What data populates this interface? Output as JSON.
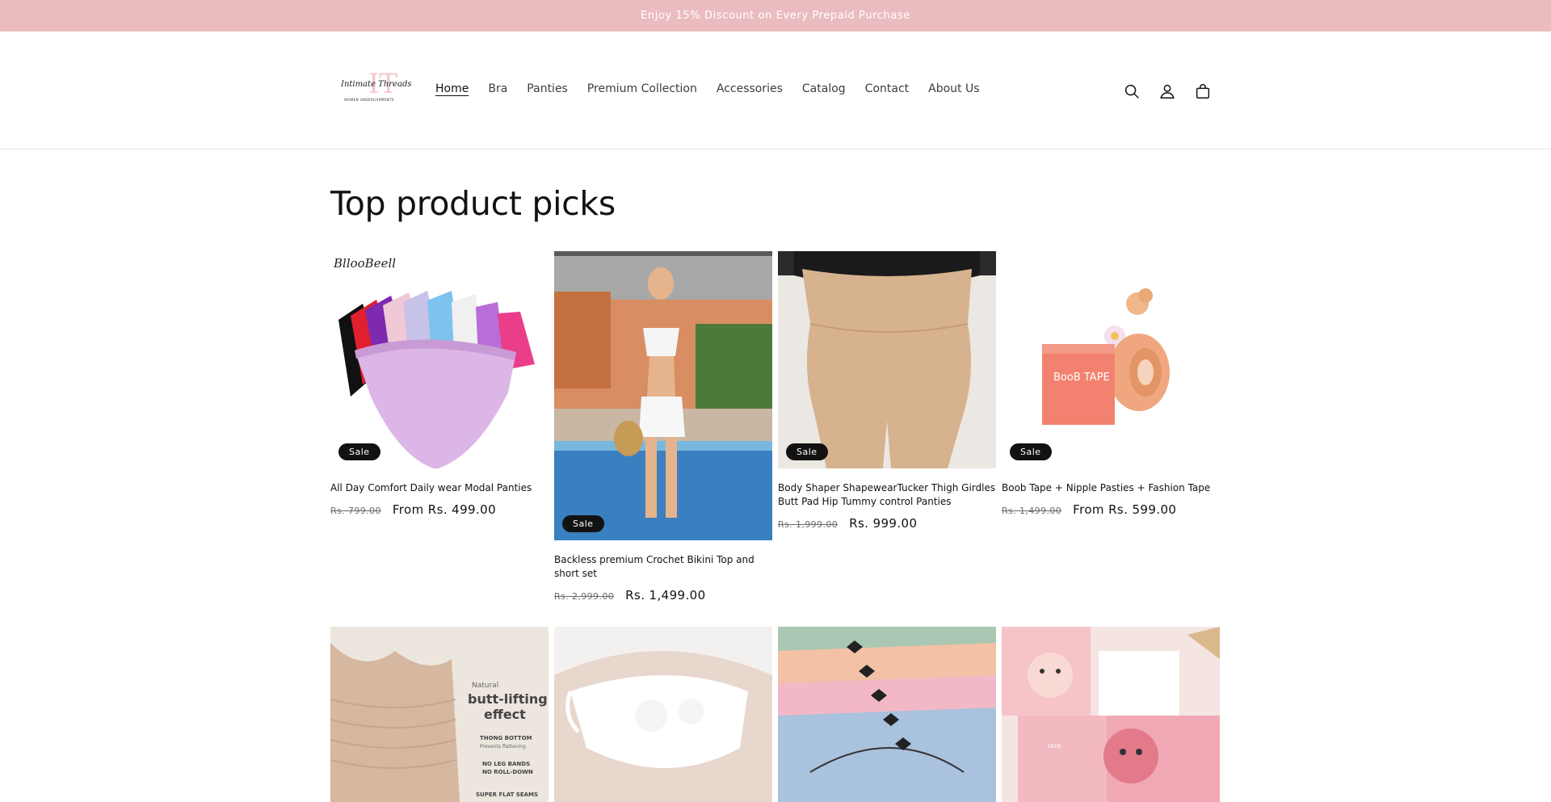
{
  "announcement": "Enjoy 15% Discount on Every Prepaid Purchase",
  "brand": {
    "script": "Intimate Threads",
    "tagline": "WOMEN UNDERGARMENTS"
  },
  "nav": [
    {
      "label": "Home",
      "active": true
    },
    {
      "label": "Bra"
    },
    {
      "label": "Panties"
    },
    {
      "label": "Premium Collection"
    },
    {
      "label": "Accessories"
    },
    {
      "label": "Catalog"
    },
    {
      "label": "Contact"
    },
    {
      "label": "About Us"
    }
  ],
  "header_icons": [
    "search-icon",
    "account-icon",
    "cart-icon"
  ],
  "section_title": "Top product picks",
  "badge_label": "Sale",
  "products": [
    {
      "title": "All Day Comfort Daily wear Modal Panties",
      "old_price": "Rs. 799.00",
      "price": "From Rs. 499.00",
      "badge": "Sale",
      "image_text": "BllooBeell"
    },
    {
      "title": "Backless premium Crochet Bikini Top and short set",
      "old_price": "Rs. 2,999.00",
      "price": "Rs. 1,499.00",
      "badge": "Sale"
    },
    {
      "title": "Body Shaper ShapewearTucker Thigh Girdles Butt Pad Hip Tummy control Panties",
      "old_price": "Rs. 1,999.00",
      "price": "Rs. 999.00",
      "badge": "Sale"
    },
    {
      "title": "Boob Tape + Nipple Pasties + Fashion Tape",
      "old_price": "Rs. 1,499.00",
      "price": "From Rs. 599.00",
      "badge": "Sale",
      "image_text": "BooB TAPE"
    },
    {
      "image_text": {
        "l1": "Natural",
        "l2": "butt-lifting",
        "l3": "effect",
        "l4": "THONG BOTTOM",
        "l5": "Prevents flattening",
        "l6": "NO LEG BANDS",
        "l7": "NO ROLL-DOWN",
        "l8": "SUPER FLAT SEAMS"
      }
    },
    {},
    {},
    {
      "image_text": "DEER"
    }
  ],
  "colors": {
    "announcement_bg": "#ebbcbf",
    "badge_bg": "#121212",
    "text": "#121212"
  }
}
